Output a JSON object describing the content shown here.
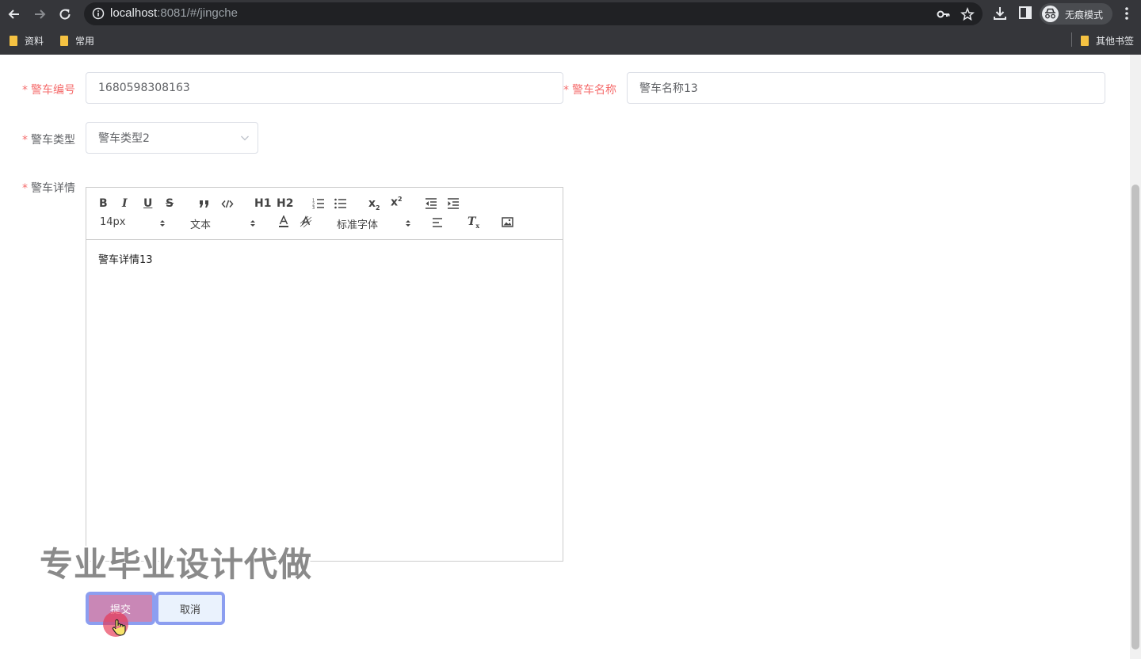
{
  "browser": {
    "url_host": "localhost",
    "url_rest": ":8081/#/jingche",
    "profile_label": "无痕模式",
    "bookmarks": [
      {
        "label": "资料"
      },
      {
        "label": "常用"
      }
    ],
    "other_bookmarks": "其他书签"
  },
  "form": {
    "fields": {
      "vehicle_no": {
        "label": "警车编号",
        "value": "1680598308163"
      },
      "vehicle_name": {
        "label": "警车名称",
        "value": "警车名称13"
      },
      "vehicle_type": {
        "label": "警车类型",
        "value": "警车类型2"
      },
      "vehicle_detail": {
        "label": "警车详情"
      }
    },
    "editor": {
      "font_size": "14px",
      "heading_picker": "文本",
      "font_family": "标准字体",
      "content": "警车详情13",
      "h1": "H1",
      "h2": "H2"
    },
    "buttons": {
      "submit": "提交",
      "cancel": "取消"
    }
  },
  "overlay": {
    "watermark": "专业毕业设计代做"
  },
  "colors": {
    "required": "#f56c6c",
    "chrome_bg": "#35363a",
    "submit_bg": "#c987b6",
    "focus_ring": "#8c9ef0"
  }
}
